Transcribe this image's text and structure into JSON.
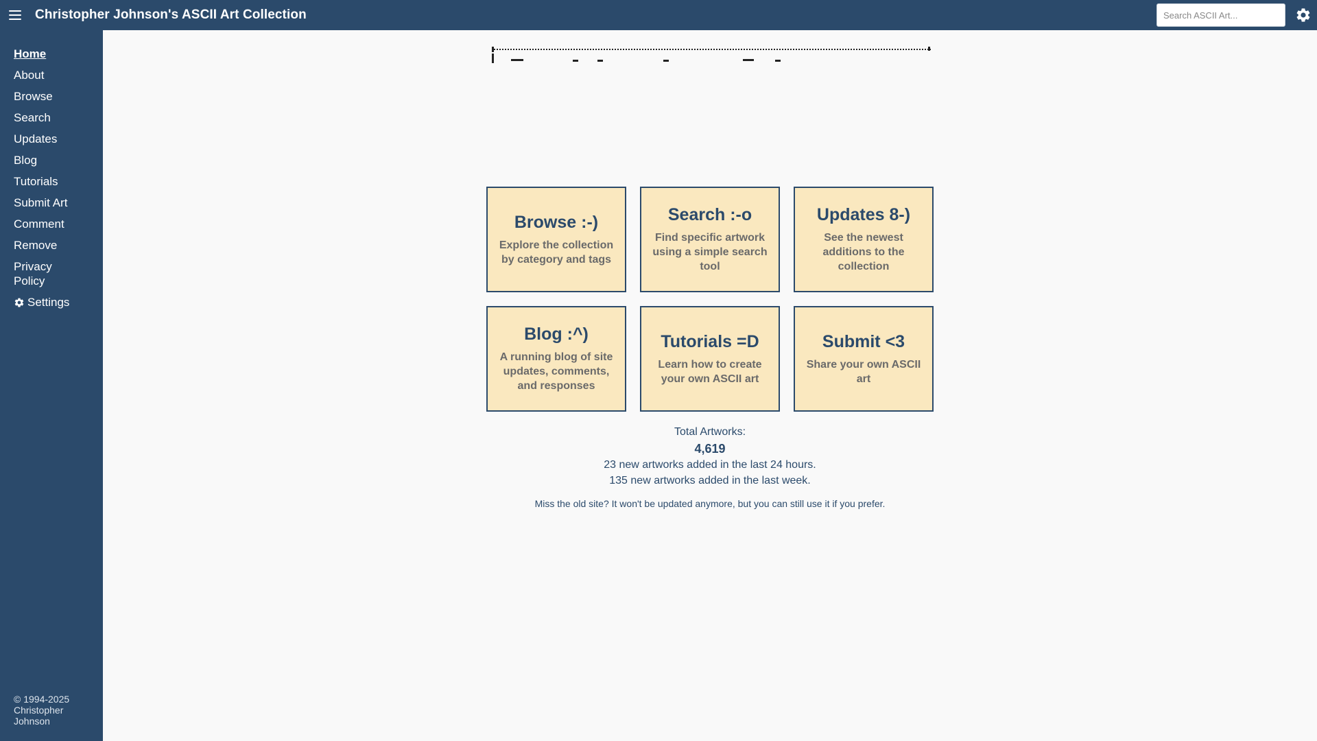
{
  "header": {
    "title": "Christopher Johnson's ASCII Art Collection",
    "search_placeholder": "Search ASCII Art..."
  },
  "sidebar": {
    "items": [
      {
        "label": "Home",
        "active": true
      },
      {
        "label": "About"
      },
      {
        "label": "Browse"
      },
      {
        "label": "Search"
      },
      {
        "label": "Updates"
      },
      {
        "label": "Blog"
      },
      {
        "label": "Tutorials"
      },
      {
        "label": "Submit Art"
      },
      {
        "label": "Comment"
      },
      {
        "label": "Remove"
      },
      {
        "label": "Privacy Policy"
      },
      {
        "label": "Settings",
        "icon": "gear-icon"
      }
    ],
    "copyright": "© 1994-2025 Christopher Johnson"
  },
  "tiles": [
    {
      "title": "Browse :-)",
      "description": "Explore the collection by category and tags"
    },
    {
      "title": "Search :-o",
      "description": "Find specific artwork using a simple search tool"
    },
    {
      "title": "Updates 8-)",
      "description": "See the newest additions to the collection"
    },
    {
      "title": "Blog :^)",
      "description": "A running blog of site updates, comments, and responses"
    },
    {
      "title": "Tutorials =D",
      "description": "Learn how to create your own ASCII art"
    },
    {
      "title": "Submit <3",
      "description": "Share your own ASCII art"
    }
  ],
  "stats": {
    "total_label": "Total Artworks:",
    "total_count": "4,619",
    "last_24h": "23 new artworks added in the last 24 hours.",
    "last_week": "135 new artworks added in the last week.",
    "old_site_note": "Miss the old site? It won't be updated anymore, but you can still use it if you prefer."
  },
  "colors": {
    "navy": "#2b4a6b",
    "tile_bg": "#fae8bf",
    "page_bg": "#f9f9f9"
  }
}
